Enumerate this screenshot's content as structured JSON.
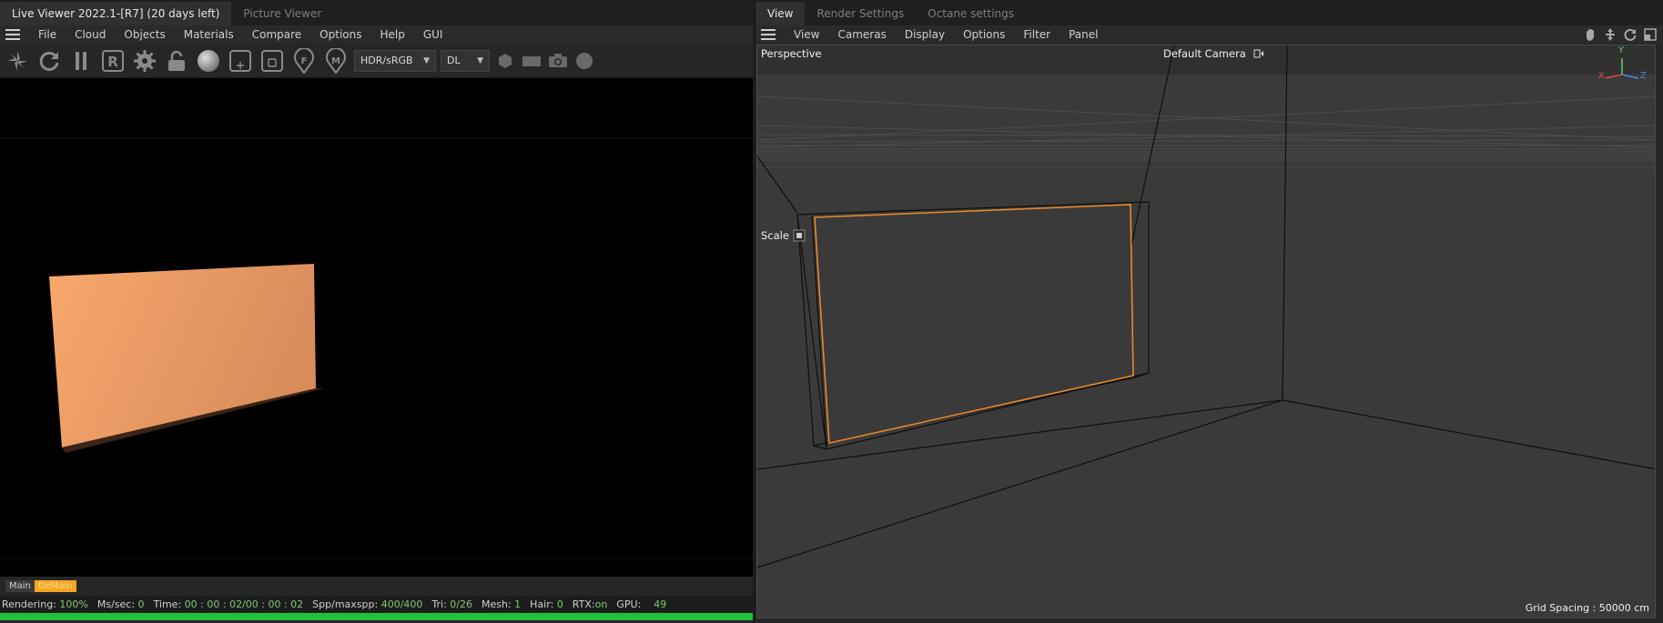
{
  "left": {
    "tabs": [
      {
        "label": "Live Viewer 2022.1-[R7] (20 days left)"
      },
      {
        "label": "Picture Viewer"
      }
    ],
    "menu": [
      "File",
      "Cloud",
      "Objects",
      "Materials",
      "Compare",
      "Options",
      "Help",
      "GUI"
    ],
    "toolbar": {
      "icons": [
        "send-icon",
        "refresh-icon",
        "pause-icon",
        "region-icon",
        "settings-gear-icon",
        "lock-icon",
        "material-sphere-icon",
        "add-region-icon",
        "small-region-icon",
        "focus-picker-icon",
        "material-picker-icon",
        "cube-icon",
        "film-icon",
        "camera-icon",
        "circle-icon"
      ],
      "region_letter": "R",
      "focus_letter": "F",
      "material_letter": "M",
      "color_space": "HDR/sRGB",
      "kernel": "DL"
    },
    "layers": [
      "Main",
      "DeMain"
    ],
    "status": {
      "rendering_label": "Rendering:",
      "rendering_val": "100%",
      "ms_label": "Ms/sec:",
      "ms_val": "0",
      "time_label": "Time:",
      "time_val": "00 : 00 : 02/00 : 00 : 02",
      "spp_label": "Spp/maxspp:",
      "spp_val": "400/400",
      "tri_label": "Tri:",
      "tri_val": "0/26",
      "mesh_label": "Mesh:",
      "mesh_val": "1",
      "hair_label": "Hair:",
      "hair_val": "0",
      "rtx_label": "RTX:",
      "rtx_val": "on",
      "gpu_label": "GPU:",
      "gpu_val": "49"
    },
    "progress": 1.0,
    "colors": {
      "plane_light": "#f8a86c",
      "plane_dark": "#d98d5b",
      "progress": "#1cc23c",
      "layer_active": "#f5a623"
    }
  },
  "right": {
    "tabs": [
      {
        "label": "View"
      },
      {
        "label": "Render Settings"
      },
      {
        "label": "Octane settings"
      }
    ],
    "menu": [
      "View",
      "Cameras",
      "Display",
      "Options",
      "Filter",
      "Panel"
    ],
    "nav_icons": [
      "pan-hand-icon",
      "move-arrows-icon",
      "rotate-icon",
      "maximize-icon"
    ],
    "viewport": {
      "projection": "Perspective",
      "camera": "Default Camera",
      "scale_label": "Scale",
      "grid_spacing": "Grid Spacing : 50000 cm",
      "axes": {
        "x": "X",
        "y": "Y",
        "z": "Z"
      }
    },
    "colors": {
      "selection": "#e8892a",
      "axis_x": "#e04a4a",
      "axis_y": "#5fd05f",
      "axis_z": "#4a8ae0"
    }
  }
}
